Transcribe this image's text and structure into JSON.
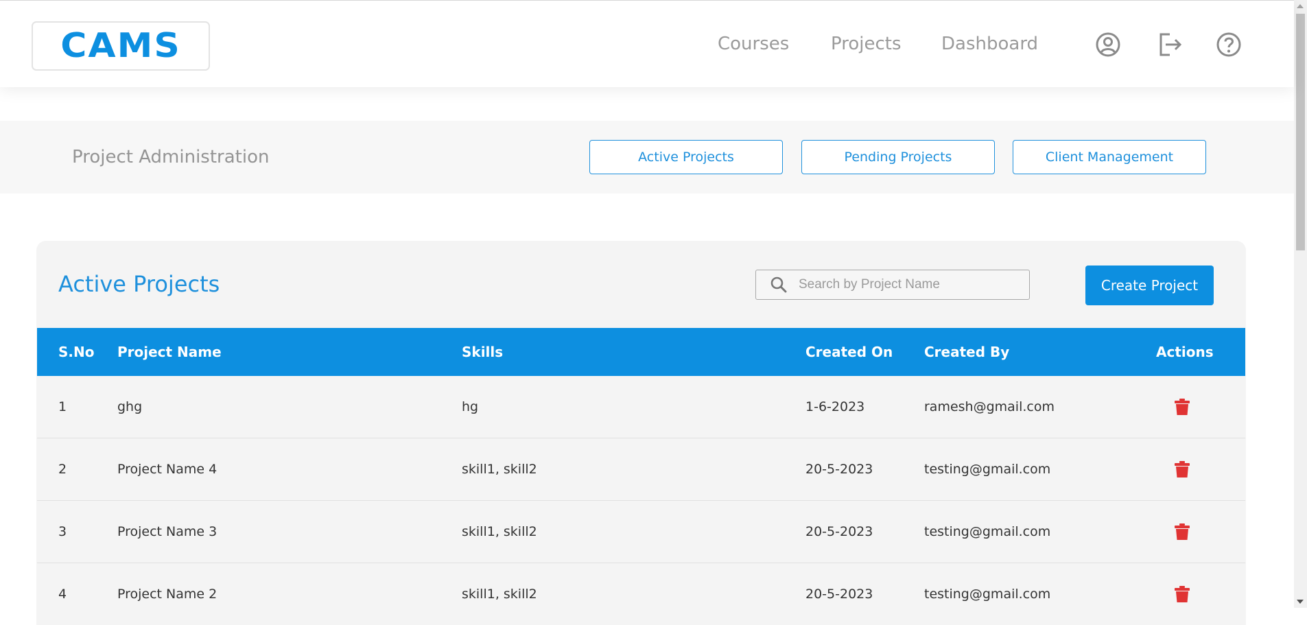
{
  "brand": {
    "logo_text": "CAMS",
    "color": "#0d8fe0"
  },
  "nav": {
    "links": [
      "Courses",
      "Projects",
      "Dashboard"
    ],
    "icons": [
      "user-circle-icon",
      "logout-icon",
      "help-icon"
    ]
  },
  "subheader": {
    "title": "Project Administration",
    "tabs": [
      "Active Projects",
      "Pending Projects",
      "Client Management"
    ]
  },
  "panel": {
    "title": "Active Projects",
    "search_placeholder": "Search by Project Name",
    "create_label": "Create Project"
  },
  "table": {
    "columns": [
      "S.No",
      "Project Name",
      "Skills",
      "Created On",
      "Created By",
      "Actions"
    ],
    "rows": [
      {
        "sno": "1",
        "name": "ghg",
        "skills": "hg",
        "created_on": "1-6-2023",
        "created_by": "ramesh@gmail.com",
        "action_icon": "trash-icon"
      },
      {
        "sno": "2",
        "name": "Project Name 4",
        "skills": "skill1, skill2",
        "created_on": "20-5-2023",
        "created_by": "testing@gmail.com",
        "action_icon": "trash-icon"
      },
      {
        "sno": "3",
        "name": "Project Name 3",
        "skills": "skill1, skill2",
        "created_on": "20-5-2023",
        "created_by": "testing@gmail.com",
        "action_icon": "trash-icon"
      },
      {
        "sno": "4",
        "name": "Project Name 2",
        "skills": "skill1, skill2",
        "created_on": "20-5-2023",
        "created_by": "testing@gmail.com",
        "action_icon": "trash-icon"
      }
    ]
  },
  "colors": {
    "accent": "#0d8fe0",
    "danger": "#e03333",
    "muted_text": "#9a9a9a"
  }
}
